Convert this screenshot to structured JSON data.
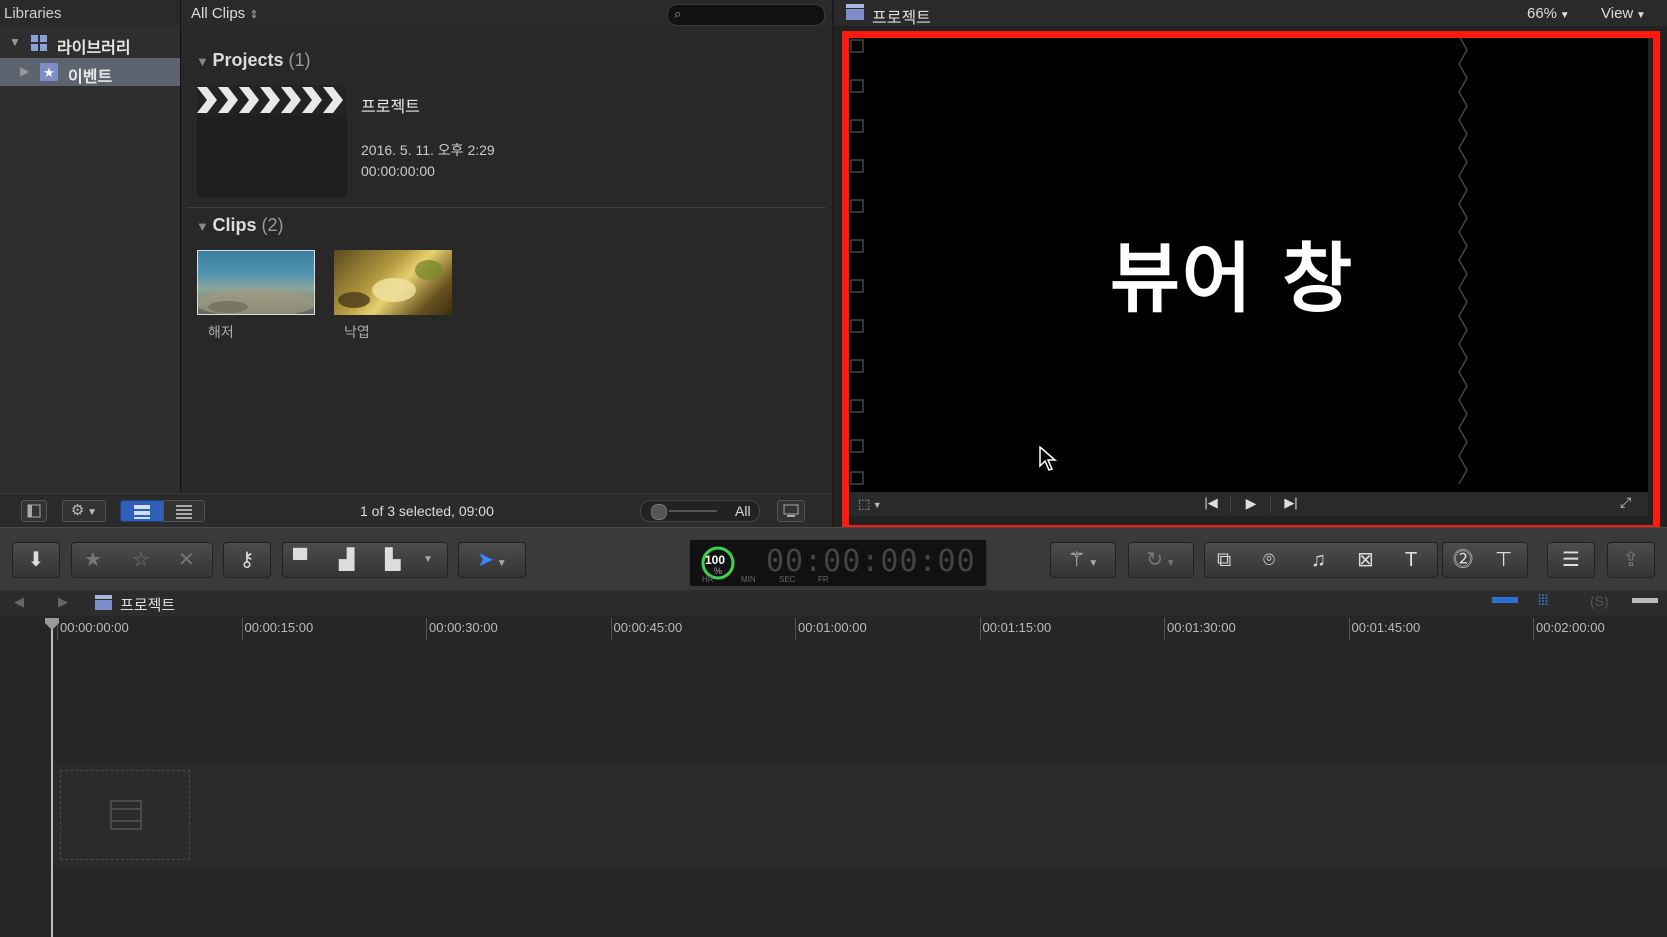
{
  "libraries": {
    "title": "Libraries",
    "items": [
      {
        "label": "라이브러리",
        "expanded": true
      },
      {
        "label": "이벤트",
        "selected": true
      }
    ]
  },
  "browser": {
    "filter": "All Clips",
    "projects": {
      "label": "Projects",
      "count": "(1)",
      "item": {
        "name": "프로젝트",
        "date": "2016. 5. 11. 오후 2:29",
        "duration": "00:00:00:00"
      }
    },
    "clips": {
      "label": "Clips",
      "count": "(2)",
      "items": [
        {
          "name": "해저"
        },
        {
          "name": "낙엽"
        }
      ]
    },
    "status": "1 of 3 selected, 09:00",
    "duration_filter": "All"
  },
  "viewer": {
    "title": "프로젝트",
    "zoom": "66%",
    "view_menu": "View",
    "overlay_text": "뷰어 창"
  },
  "toolbar": {
    "timecode": "00:00:00:00",
    "timecode_units": [
      "HR",
      "MIN",
      "SEC",
      "FR"
    ],
    "dashboard_percent": "100",
    "dashboard_unit": "%"
  },
  "timeline": {
    "project_name": "프로젝트",
    "ticks": [
      "00:00:00:00",
      "00:00:15:00",
      "00:00:30:00",
      "00:00:45:00",
      "00:01:00:00",
      "00:01:15:00",
      "00:01:30:00",
      "00:01:45:00",
      "00:02:00:00"
    ]
  },
  "colors": {
    "accent": "#2f6fd6",
    "highlight_frame": "#ff1a10"
  }
}
